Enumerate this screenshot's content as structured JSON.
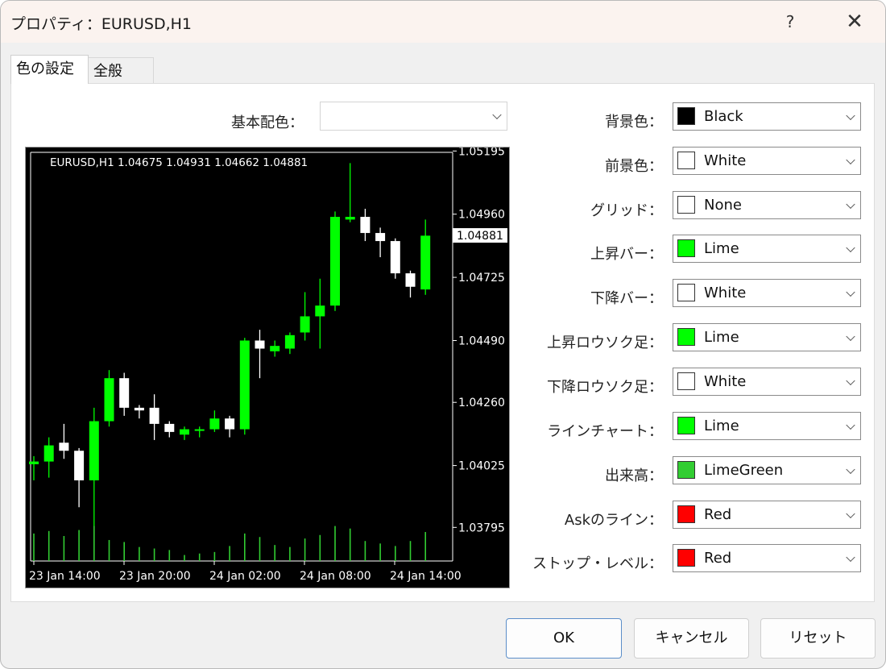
{
  "window": {
    "title": "プロパティ：EURUSD,H1",
    "help": "?",
    "close": "✕"
  },
  "tabs": [
    {
      "label": "色の設定",
      "active": true
    },
    {
      "label": "全般",
      "active": false
    }
  ],
  "scheme": {
    "label": "基本配色：",
    "value": ""
  },
  "properties": [
    {
      "label": "背景色：",
      "value": "Black",
      "color": "#000000"
    },
    {
      "label": "前景色：",
      "value": "White",
      "color": "#ffffff"
    },
    {
      "label": "グリッド：",
      "value": "None",
      "color": "#ffffff"
    },
    {
      "label": "上昇バー：",
      "value": "Lime",
      "color": "#00ff00"
    },
    {
      "label": "下降バー：",
      "value": "White",
      "color": "#ffffff"
    },
    {
      "label": "上昇ロウソク足：",
      "value": "Lime",
      "color": "#00ff00"
    },
    {
      "label": "下降ロウソク足：",
      "value": "White",
      "color": "#ffffff"
    },
    {
      "label": "ラインチャート：",
      "value": "Lime",
      "color": "#00ff00"
    },
    {
      "label": "出来高：",
      "value": "LimeGreen",
      "color": "#32cd32"
    },
    {
      "label": "Askのライン：",
      "value": "Red",
      "color": "#ff0000"
    },
    {
      "label": "ストップ・レベル：",
      "value": "Red",
      "color": "#ff0000"
    }
  ],
  "buttons": {
    "ok": "OK",
    "cancel": "キャンセル",
    "reset": "リセット"
  },
  "chart_data": {
    "type": "candlestick",
    "header": "EURUSD,H1  1.04675 1.04931 1.04662 1.04881",
    "y_ticks": [
      "1.05195",
      "1.04960",
      "1.04725",
      "1.04490",
      "1.04260",
      "1.04025",
      "1.03795"
    ],
    "current_price": "1.04881",
    "x_ticks": [
      "23 Jan 14:00",
      "23 Jan 20:00",
      "24 Jan 02:00",
      "24 Jan 08:00",
      "24 Jan 14:00"
    ],
    "ylim": [
      1.0367,
      1.0519
    ],
    "colors": {
      "background": "#000000",
      "up": "#00ff00",
      "down": "#ffffff",
      "volume": "#32cd32",
      "foreground": "#ffffff"
    },
    "candles": [
      {
        "o": 1.0403,
        "h": 1.0406,
        "l": 1.0397,
        "c": 1.0404
      },
      {
        "o": 1.0404,
        "h": 1.0413,
        "l": 1.0398,
        "c": 1.041
      },
      {
        "o": 1.0411,
        "h": 1.0418,
        "l": 1.0405,
        "c": 1.0408
      },
      {
        "o": 1.0408,
        "h": 1.0409,
        "l": 1.0387,
        "c": 1.0397
      },
      {
        "o": 1.0397,
        "h": 1.0424,
        "l": 1.0369,
        "c": 1.0419
      },
      {
        "o": 1.0419,
        "h": 1.0438,
        "l": 1.0417,
        "c": 1.0435
      },
      {
        "o": 1.0435,
        "h": 1.0437,
        "l": 1.0421,
        "c": 1.0424
      },
      {
        "o": 1.0424,
        "h": 1.0425,
        "l": 1.042,
        "c": 1.0423
      },
      {
        "o": 1.0424,
        "h": 1.0429,
        "l": 1.0412,
        "c": 1.0418
      },
      {
        "o": 1.0418,
        "h": 1.0419,
        "l": 1.0413,
        "c": 1.0415
      },
      {
        "o": 1.0414,
        "h": 1.0417,
        "l": 1.0412,
        "c": 1.0416
      },
      {
        "o": 1.0416,
        "h": 1.0417,
        "l": 1.0413,
        "c": 1.0416
      },
      {
        "o": 1.0416,
        "h": 1.0423,
        "l": 1.0415,
        "c": 1.042
      },
      {
        "o": 1.042,
        "h": 1.0421,
        "l": 1.0413,
        "c": 1.0416
      },
      {
        "o": 1.0416,
        "h": 1.045,
        "l": 1.0414,
        "c": 1.0449
      },
      {
        "o": 1.0449,
        "h": 1.0453,
        "l": 1.0435,
        "c": 1.0446
      },
      {
        "o": 1.0445,
        "h": 1.0449,
        "l": 1.0443,
        "c": 1.0447
      },
      {
        "o": 1.0446,
        "h": 1.0452,
        "l": 1.0444,
        "c": 1.0451
      },
      {
        "o": 1.0452,
        "h": 1.0467,
        "l": 1.0449,
        "c": 1.0458
      },
      {
        "o": 1.0458,
        "h": 1.0472,
        "l": 1.0446,
        "c": 1.0462
      },
      {
        "o": 1.0462,
        "h": 1.0497,
        "l": 1.046,
        "c": 1.0495
      },
      {
        "o": 1.0494,
        "h": 1.0515,
        "l": 1.0493,
        "c": 1.0495
      },
      {
        "o": 1.0495,
        "h": 1.0498,
        "l": 1.0486,
        "c": 1.0489
      },
      {
        "o": 1.0489,
        "h": 1.0491,
        "l": 1.048,
        "c": 1.0486
      },
      {
        "o": 1.0486,
        "h": 1.0487,
        "l": 1.0472,
        "c": 1.0474
      },
      {
        "o": 1.0474,
        "h": 1.0475,
        "l": 1.0465,
        "c": 1.0469
      },
      {
        "o": 1.0468,
        "h": 1.0494,
        "l": 1.0466,
        "c": 1.0488
      }
    ],
    "volumes": [
      0.55,
      0.6,
      0.5,
      0.62,
      0.7,
      0.42,
      0.38,
      0.28,
      0.25,
      0.22,
      0.12,
      0.15,
      0.18,
      0.3,
      0.55,
      0.48,
      0.32,
      0.28,
      0.45,
      0.52,
      0.7,
      0.65,
      0.4,
      0.35,
      0.3,
      0.4,
      0.58
    ]
  }
}
